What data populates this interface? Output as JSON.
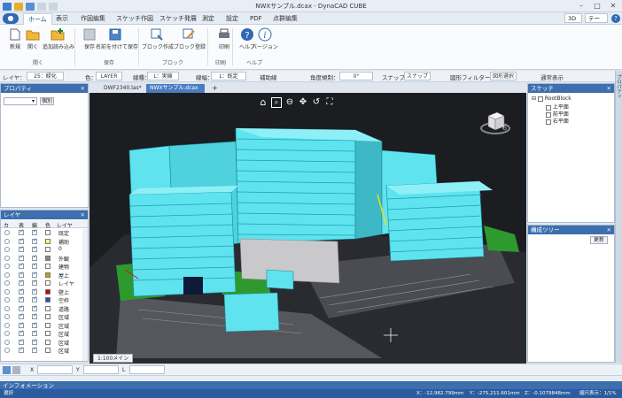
{
  "app": {
    "title": "NWXサンプル.dcax - DynaCAD CUBE"
  },
  "ribbon_tabs": [
    "ホーム",
    "表示",
    "作図編集",
    "スケッチ作図",
    "スケッチ発展",
    "測定",
    "設定",
    "PDF",
    "点群編集"
  ],
  "right_selects": {
    "view": "3D",
    "theme": "テーマ"
  },
  "ribbon": {
    "buttons": [
      {
        "label": "新規"
      },
      {
        "label": "開く"
      },
      {
        "label": "追加読み込み"
      },
      {
        "label": "保存"
      },
      {
        "label": "名前を付けて保存"
      },
      {
        "label": "ブロック作成"
      },
      {
        "label": "ブロック登録"
      },
      {
        "label": "印刷"
      },
      {
        "label": "ヘルプ"
      },
      {
        "label": "バージョン"
      }
    ],
    "groups": [
      "開く",
      "保存",
      "ブロック",
      "印刷",
      "ヘルプ"
    ]
  },
  "propbar": {
    "layer_label": "レイヤ：",
    "layer_value": "25：緑化",
    "color_label": "色：",
    "color_value": "LAYER",
    "linetype_label": "線種：",
    "linetype_value": "L：実線",
    "lineweight_label": "線幅：",
    "lineweight_value": "L：既定",
    "aux_label": "補助線",
    "angle_label": "角度規制：",
    "angle_value": "0°",
    "snap_label": "スナップ：",
    "snap_value": "スナップ",
    "filter_label": "図形フィルター：",
    "filter_value": "図形選択",
    "display_label": "通常表示"
  },
  "right_strip_label": "プロパティ",
  "properties_panel": {
    "title": "プロパティ",
    "select_value": "",
    "filter_button": "個別"
  },
  "layer_panel": {
    "title": "レイヤ",
    "columns": [
      "カ",
      "表",
      "編",
      "色",
      "レイヤ"
    ],
    "rows": [
      {
        "name": "既定",
        "color": "#ffffff"
      },
      {
        "name": "補助",
        "color": "#ffff66"
      },
      {
        "name": "0",
        "color": "#ffffff"
      },
      {
        "name": "外観",
        "color": "#888888"
      },
      {
        "name": "建物",
        "color": "#ffffff"
      },
      {
        "name": "屋上",
        "color": "#c8a000"
      },
      {
        "name": "レイヤ",
        "color": "#ffffff"
      },
      {
        "name": "壁上",
        "color": "#cc0000"
      },
      {
        "name": "空枠",
        "color": "#3344cc"
      },
      {
        "name": "道路",
        "color": "#ffffff"
      },
      {
        "name": "区域",
        "color": "#ffffff"
      },
      {
        "name": "区域",
        "color": "#ffffff"
      },
      {
        "name": "区域",
        "color": "#ffffff"
      },
      {
        "name": "区域",
        "color": "#ffffff"
      },
      {
        "name": "区域",
        "color": "#ffffff"
      }
    ]
  },
  "doc_tabs": [
    {
      "label": "DWF2340.las*"
    },
    {
      "label": "NWXサンプル.dcax"
    }
  ],
  "viewport": {
    "layout_tab": "1:100メイン",
    "cube_label": "右"
  },
  "sketch_panel": {
    "title": "スケッチ",
    "tree": [
      {
        "label": "RootBlock"
      },
      {
        "label": "上平面"
      },
      {
        "label": "前平面"
      },
      {
        "label": "右平面"
      }
    ]
  },
  "tree_panel": {
    "title": "構成ツリー",
    "update_button": "更新"
  },
  "cmd": {
    "x_label": "X",
    "y_label": "Y",
    "l_label": "L"
  },
  "info": {
    "title": "インフォメーション"
  },
  "status": {
    "mode": "選択",
    "x": "X：-12,982.799mm",
    "y": "Y：-275,211.601mm",
    "z": "Z：-0.1079848mm",
    "scale": "縮尺表示：1/1%"
  },
  "colors": {
    "accent": "#3d6eae",
    "building": "#5fe3ee",
    "ground": "#2a2b30"
  }
}
